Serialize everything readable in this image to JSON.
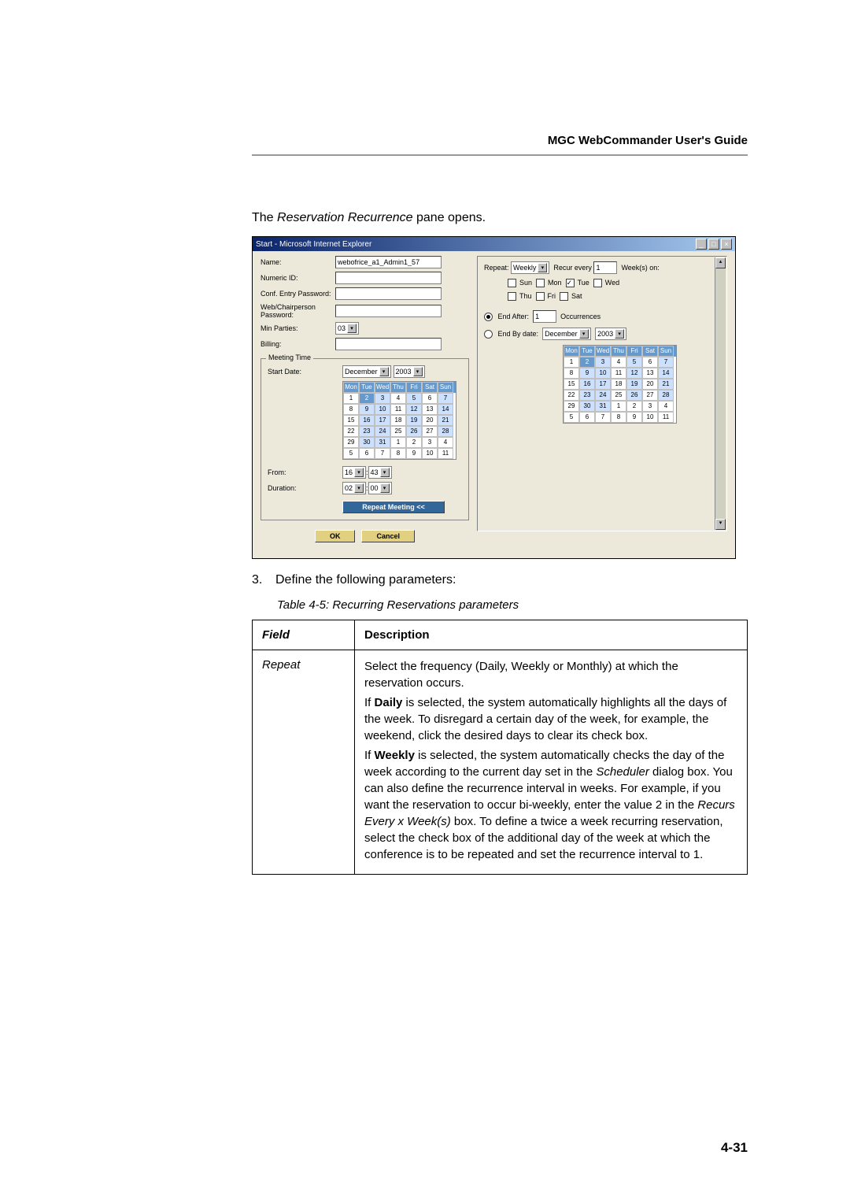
{
  "header": {
    "title": "MGC WebCommander User's Guide"
  },
  "intro": {
    "prefix": "The ",
    "pane_name": "Reservation Recurrence",
    "suffix": " pane opens."
  },
  "screenshot": {
    "window_title": "Start - Microsoft Internet Explorer",
    "labels": {
      "name": "Name:",
      "numeric_id": "Numeric ID:",
      "conf_entry_pw": "Conf. Entry Password:",
      "web_chair_pw": "Web/Chairperson Password:",
      "min_parties": "Min Parties:",
      "billing": "Billing:",
      "meeting_time": "Meeting Time",
      "start_date": "Start Date:",
      "from": "From:",
      "duration": "Duration:"
    },
    "values": {
      "name_value": "webofrice_a1_Admin1_57",
      "min_parties_value": "03",
      "month": "December",
      "year": "2003",
      "from_hour": "16",
      "from_min": "43",
      "duration_hour": "02",
      "duration_min": "00",
      "repeat_btn": "Repeat Meeting <<",
      "ok": "OK",
      "cancel": "Cancel"
    },
    "calendar": {
      "days": [
        "Mon",
        "Tue",
        "Wed",
        "Thu",
        "Fri",
        "Sat",
        "Sun"
      ],
      "rows": [
        [
          "1",
          "2",
          "3",
          "4",
          "5",
          "6",
          "7"
        ],
        [
          "8",
          "9",
          "10",
          "11",
          "12",
          "13",
          "14"
        ],
        [
          "15",
          "16",
          "17",
          "18",
          "19",
          "20",
          "21"
        ],
        [
          "22",
          "23",
          "24",
          "25",
          "26",
          "27",
          "28"
        ],
        [
          "29",
          "30",
          "31",
          "1",
          "2",
          "3",
          "4"
        ],
        [
          "5",
          "6",
          "7",
          "8",
          "9",
          "10",
          "11"
        ]
      ]
    },
    "right": {
      "repeat_label": "Repeat:",
      "repeat_value": "Weekly",
      "recur_label": "Recur every",
      "recur_value": "1",
      "weeks_on": "Week(s) on:",
      "day_sun": "Sun",
      "day_mon": "Mon",
      "day_tue": "Tue",
      "day_wed": "Wed",
      "day_thu": "Thu",
      "day_fri": "Fri",
      "day_sat": "Sat",
      "end_after": "End After:",
      "end_after_value": "1",
      "occurrences": "Occurrences",
      "end_by_date": "End By date:",
      "end_month": "December",
      "end_year": "2003"
    }
  },
  "step": {
    "num": "3.",
    "text": "Define the following parameters:"
  },
  "table_caption": "Table 4-5:  Recurring Reservations parameters",
  "table": {
    "head_field": "Field",
    "head_desc": "Description",
    "row1_field": "Repeat",
    "desc_p1_a": "Select the frequency (Daily, Weekly or Monthly) at which the reservation occurs.",
    "desc_p2_pre": "If ",
    "desc_p2_bold": "Daily",
    "desc_p2_post": " is selected, the system automatically highlights all the days of the week. To disregard a certain day of the week, for example, the weekend, click the desired days to clear its check box.",
    "desc_p3_pre": "If ",
    "desc_p3_bold": "Weekly",
    "desc_p3_mid1": " is selected, the system automatically checks the day of the week according to the current day set in the ",
    "desc_p3_em1": "Scheduler",
    "desc_p3_mid2": " dialog box. You can also define the recurrence interval in weeks. For example, if you want the reservation to occur bi-weekly, enter the value 2 in the ",
    "desc_p3_em2": "Recurs Every x Week(s)",
    "desc_p3_post": " box. To define a twice a week recurring reservation, select the check box of the additional day of the week at which the conference is to be repeated and set the recurrence interval to 1."
  },
  "page_number": "4-31"
}
